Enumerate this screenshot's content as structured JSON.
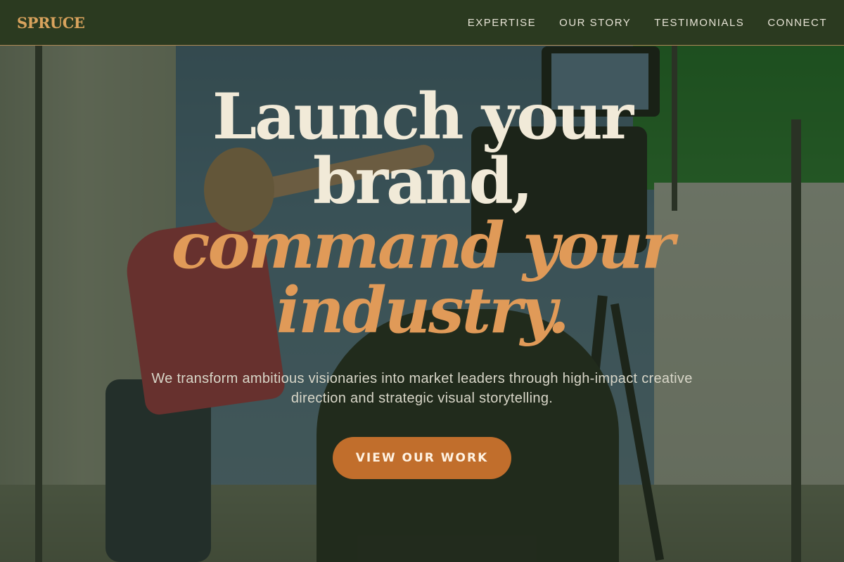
{
  "header": {
    "logo": "SPRUCE",
    "nav": [
      {
        "label": "EXPERTISE"
      },
      {
        "label": "OUR STORY"
      },
      {
        "label": "TESTIMONIALS"
      },
      {
        "label": "CONNECT"
      }
    ]
  },
  "hero": {
    "headline_lines": [
      "Launch your",
      "brand,",
      "command your",
      "industry."
    ],
    "subtitle": "We transform ambitious visionaries into market leaders through high-impact creative direction and strategic visual storytelling.",
    "cta_label": "VIEW OUR WORK"
  },
  "colors": {
    "header_bg": "#2b3a20",
    "logo": "#d9a35d",
    "headline_light": "#f1ead8",
    "headline_accent": "#e09a58",
    "cta_bg": "#c16e2c"
  }
}
